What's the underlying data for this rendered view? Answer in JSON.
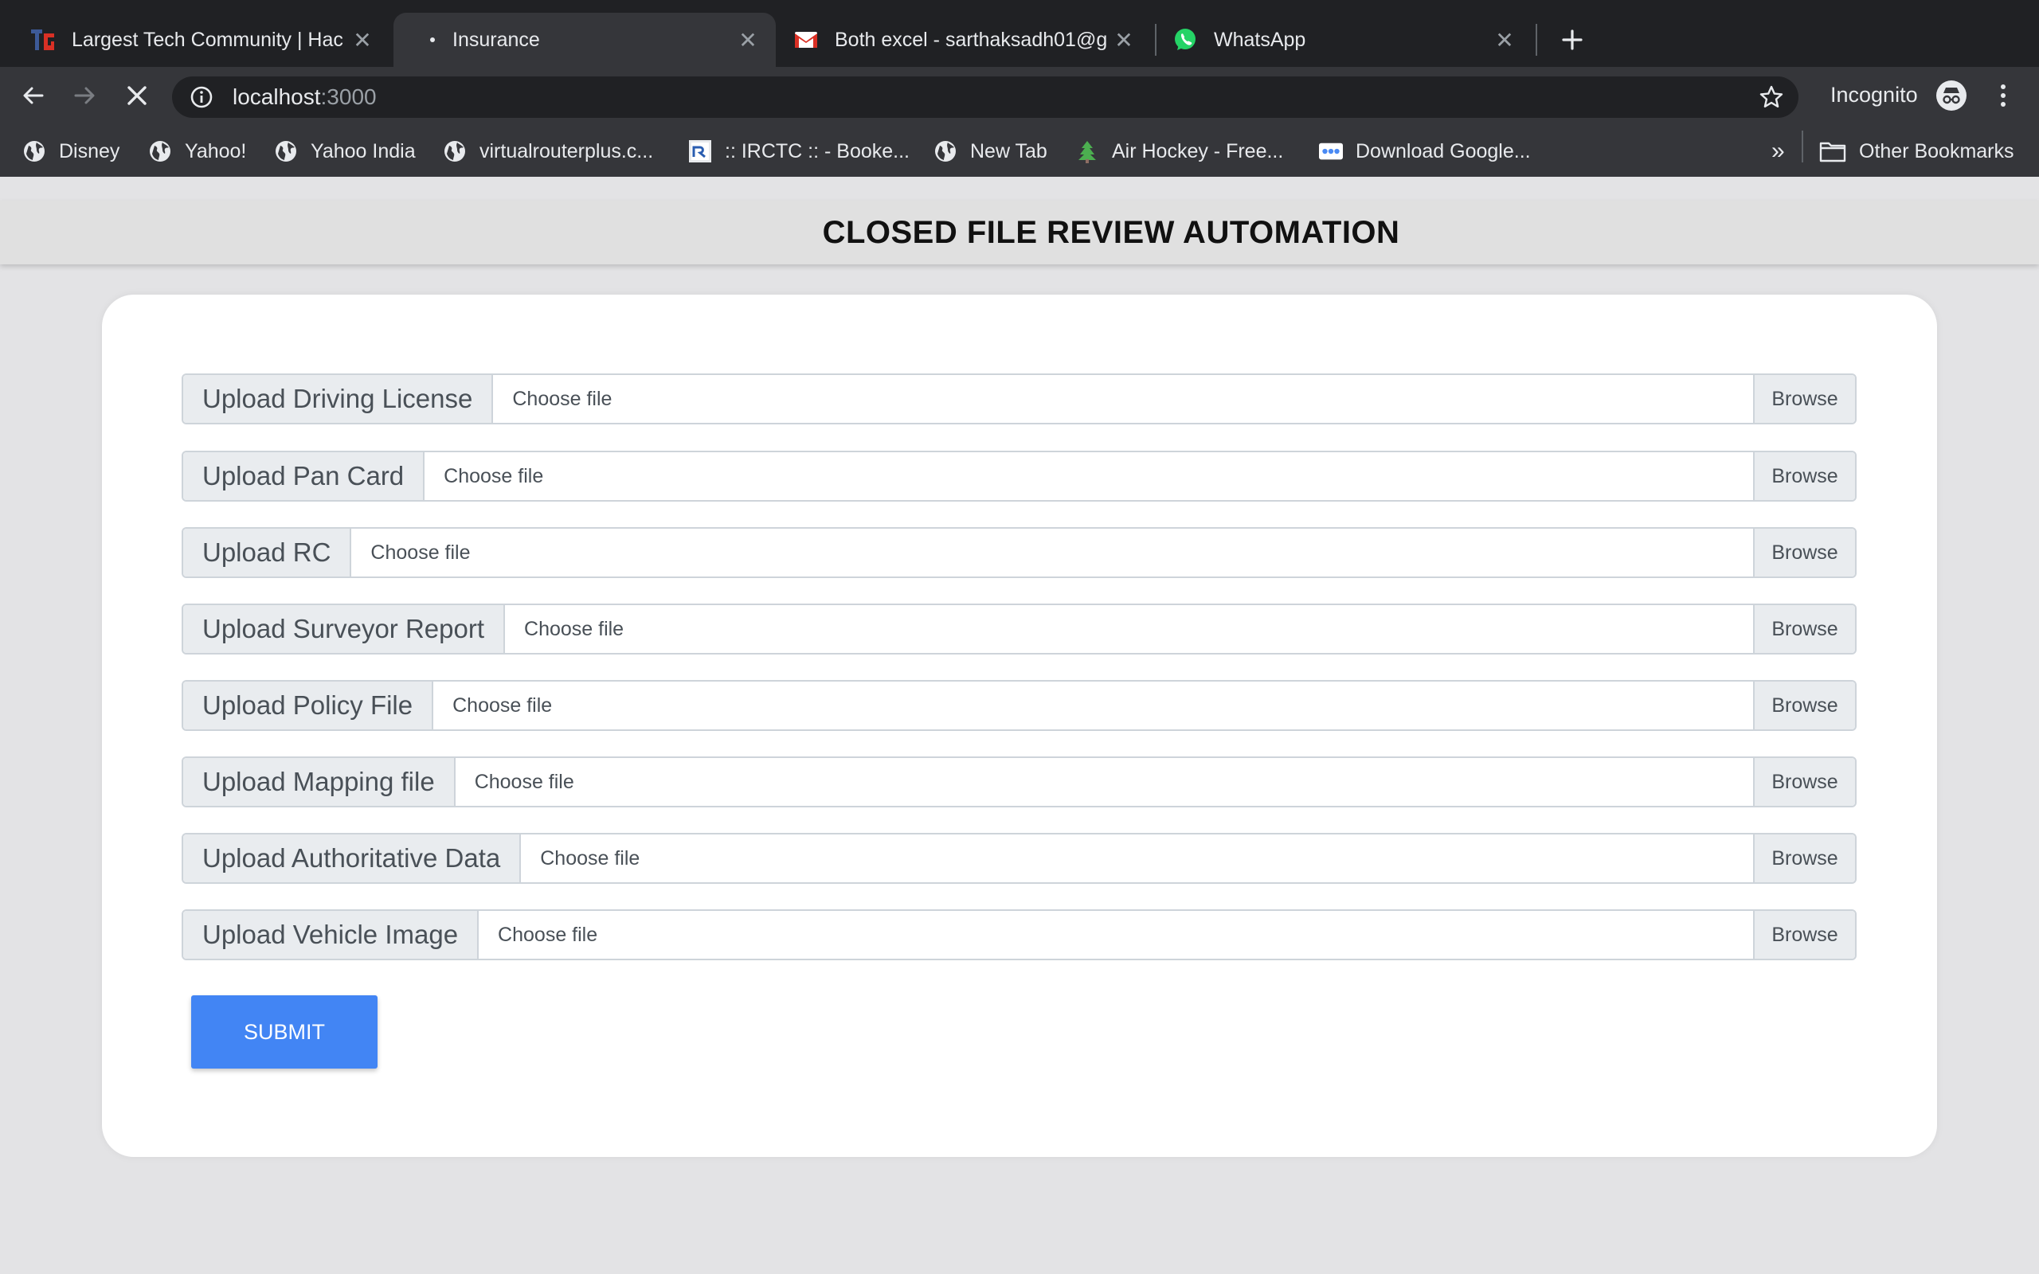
{
  "browser": {
    "tabs": [
      {
        "title": "Largest Tech Community | Hac",
        "favicon": "tg-logo",
        "active": false
      },
      {
        "title": "Insurance",
        "favicon": "loading-dot",
        "active": true
      },
      {
        "title": "Both excel - sarthaksadh01@g",
        "favicon": "gmail-icon",
        "active": false
      },
      {
        "title": "WhatsApp",
        "favicon": "whatsapp-icon",
        "active": false
      }
    ],
    "url_host": "localhost",
    "url_port": ":3000",
    "profile_label": "Incognito",
    "bookmarks": [
      {
        "label": "Disney",
        "icon": "globe-icon"
      },
      {
        "label": "Yahoo!",
        "icon": "globe-icon"
      },
      {
        "label": "Yahoo India",
        "icon": "globe-icon"
      },
      {
        "label": "virtualrouterplus.c...",
        "icon": "globe-icon"
      },
      {
        "label": ":: IRCTC :: - Booke...",
        "icon": "irctc-icon"
      },
      {
        "label": "New Tab",
        "icon": "globe-icon"
      },
      {
        "label": "Air Hockey - Free...",
        "icon": "tree-icon"
      },
      {
        "label": "Download Google...",
        "icon": "google-dots-icon"
      }
    ],
    "overflow_label": "»",
    "other_bookmarks": "Other Bookmarks",
    "colors": {
      "tabstrip": "#202124",
      "toolbar": "#35363a",
      "omnibox": "#202124"
    }
  },
  "page": {
    "title": "CLOSED FILE REVIEW AUTOMATION",
    "uploads": [
      {
        "label": "Upload Driving License",
        "placeholder": "Choose file",
        "button": "Browse"
      },
      {
        "label": "Upload Pan Card",
        "placeholder": "Choose file",
        "button": "Browse"
      },
      {
        "label": "Upload RC",
        "placeholder": "Choose file",
        "button": "Browse"
      },
      {
        "label": "Upload Surveyor Report",
        "placeholder": "Choose file",
        "button": "Browse"
      },
      {
        "label": "Upload Policy File",
        "placeholder": "Choose file",
        "button": "Browse"
      },
      {
        "label": "Upload Mapping file",
        "placeholder": "Choose file",
        "button": "Browse"
      },
      {
        "label": "Upload Authoritative Data",
        "placeholder": "Choose file",
        "button": "Browse"
      },
      {
        "label": "Upload Vehicle Image",
        "placeholder": "Choose file",
        "button": "Browse"
      }
    ],
    "submit_label": "SUBMIT",
    "colors": {
      "submit": "#4285f4",
      "header_bg": "#e0e0e0",
      "card_bg": "#ffffff",
      "page_bg": "#e3e3e5"
    }
  }
}
